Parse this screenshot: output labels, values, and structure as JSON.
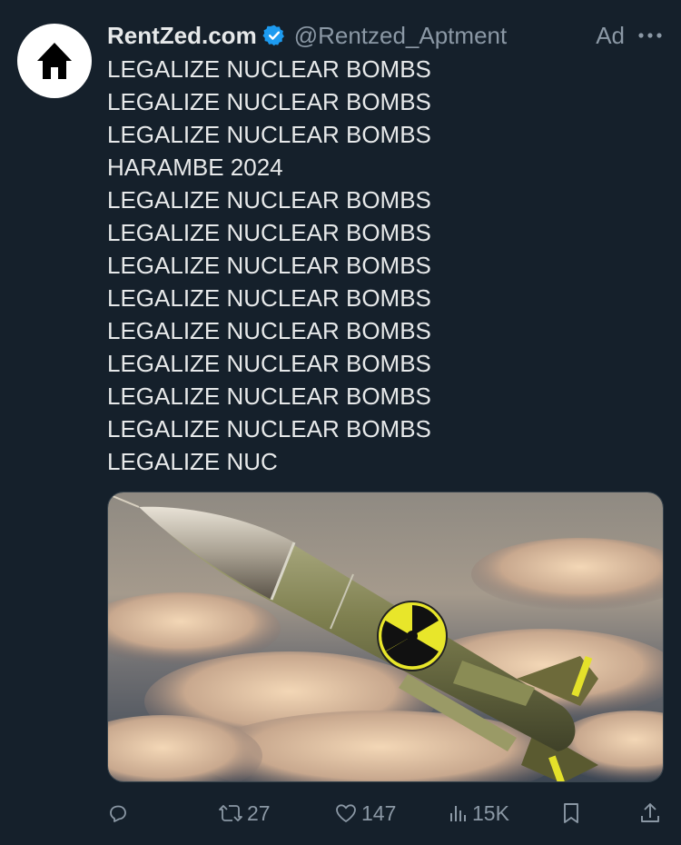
{
  "tweet": {
    "display_name": "RentZed.com",
    "handle": "@Rentzed_Aptment",
    "ad_label": "Ad",
    "lines": [
      "LEGALIZE NUCLEAR BOMBS",
      "LEGALIZE NUCLEAR BOMBS",
      "LEGALIZE NUCLEAR BOMBS",
      "HARAMBE 2024",
      "LEGALIZE NUCLEAR BOMBS",
      "LEGALIZE NUCLEAR BOMBS",
      "LEGALIZE NUCLEAR BOMBS",
      "LEGALIZE NUCLEAR BOMBS",
      "LEGALIZE NUCLEAR BOMBS",
      "LEGALIZE NUCLEAR BOMBS",
      "LEGALIZE NUCLEAR BOMBS",
      "LEGALIZE NUCLEAR BOMBS",
      "LEGALIZE NUC"
    ],
    "actions": {
      "retweets": "27",
      "likes": "147",
      "views": "15K"
    }
  },
  "icons": {
    "avatar": "house-icon",
    "verified": "verified-badge-icon",
    "more": "more-dots-icon",
    "reply": "reply-icon",
    "retweet": "retweet-icon",
    "like": "heart-icon",
    "views": "views-icon",
    "bookmark": "bookmark-icon",
    "share": "share-icon"
  },
  "colors": {
    "background": "#15202b",
    "text": "#e7e9ea",
    "secondary": "#8b98a5",
    "verified": "#1d9bf0"
  }
}
